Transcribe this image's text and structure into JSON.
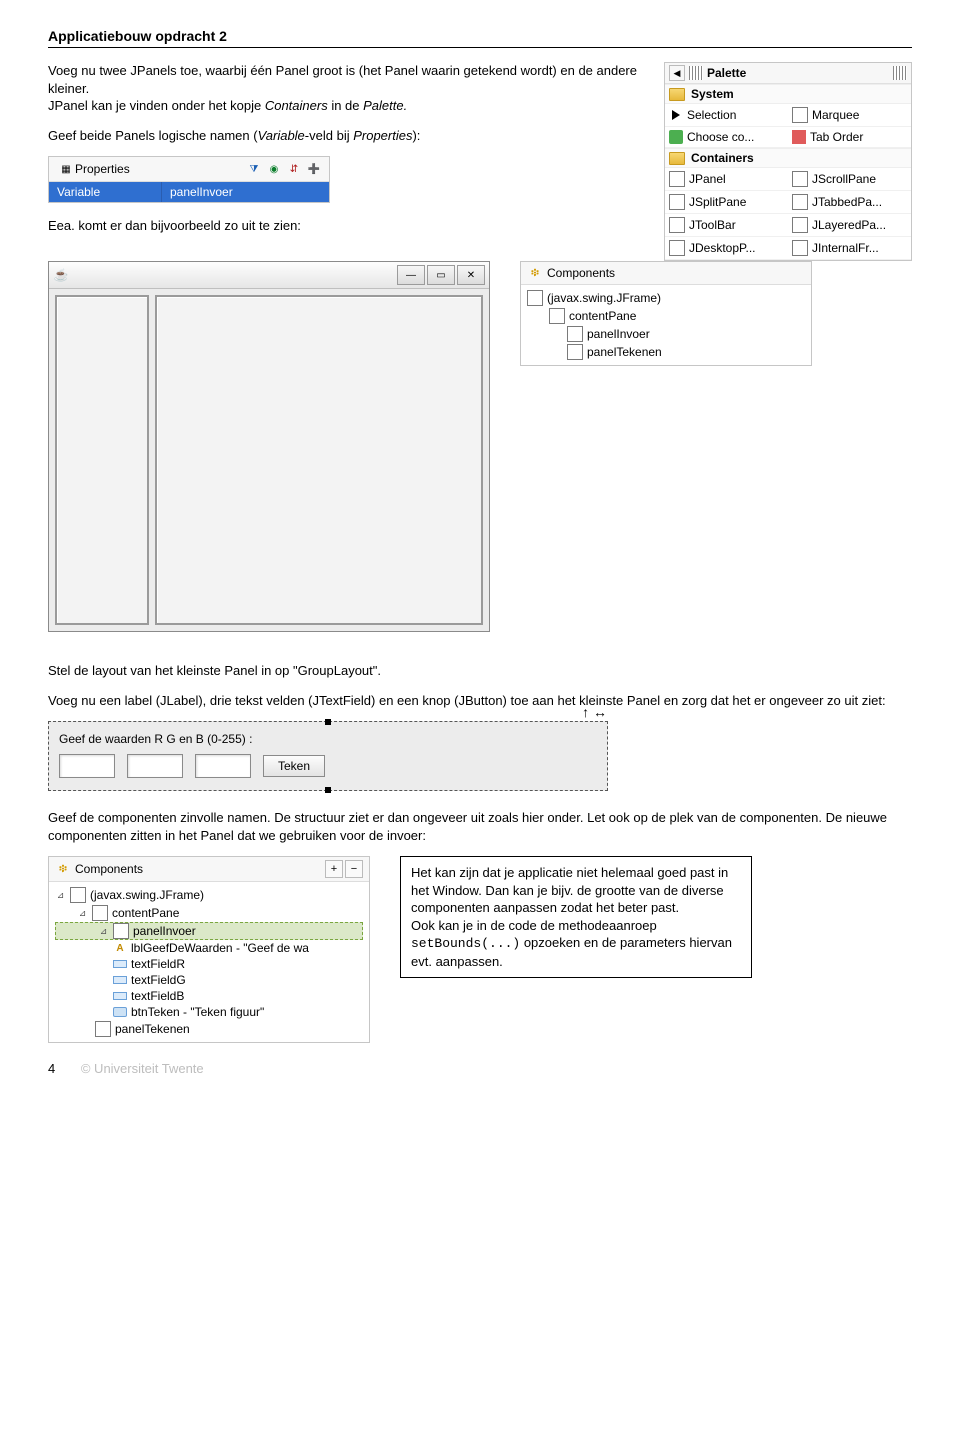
{
  "header": {
    "title": "Applicatiebouw opdracht 2"
  },
  "para1_a": "Voeg nu twee JPanels toe, waarbij één Panel groot is (het Panel waarin getekend wordt) en de andere kleiner.",
  "para1_b_pre": "JPanel kan je vinden onder het kopje ",
  "para1_b_i1": "Containers",
  "para1_b_mid": " in de ",
  "para1_b_i2": "Palette.",
  "para2_pre": "Geef beide Panels logische namen (",
  "para2_i1": "Variable",
  "para2_mid": "-veld bij ",
  "para2_i2": "Properties",
  "para2_post": "):",
  "para3": "Eea. komt er dan bijvoorbeeld zo uit te zien:",
  "para4": "Stel de layout van het kleinste Panel in op \"GroupLayout\".",
  "para5": "Voeg nu een label (JLabel), drie tekst velden (JTextField) en een knop (JButton) toe aan het kleinste Panel en zorg dat het er ongeveer zo uit ziet:",
  "para6": "Geef de componenten zinvolle namen. De structuur ziet er dan ongeveer uit zoals hier onder. Let ook op de plek van de componenten. De nieuwe componenten zitten in het Panel dat we gebruiken voor de invoer:",
  "note_l1": "Het kan zijn dat je applicatie niet helemaal goed past in het Window. Dan kan je bijv. de grootte van de diverse componenten aanpassen zodat het beter past.",
  "note_l2_pre": "Ook kan je in de code de methodeaanroep ",
  "note_code": "setBounds(...)",
  "note_l2_post": " opzoeken en de parameters hiervan evt. aanpassen.",
  "palette": {
    "title": "Palette",
    "folders": {
      "system": "System",
      "containers": "Containers"
    },
    "system_items": [
      "Selection",
      "Marquee",
      "Choose co...",
      "Tab Order"
    ],
    "container_items": [
      "JPanel",
      "JScrollPane",
      "JSplitPane",
      "JTabbedPa...",
      "JToolBar",
      "JLayeredPa...",
      "JDesktopP...",
      "JInternalFr..."
    ]
  },
  "properties": {
    "title": "Properties",
    "key": "Variable",
    "value": "panelInvoer"
  },
  "components1": {
    "title": "Components",
    "root": "(javax.swing.JFrame)",
    "n1": "contentPane",
    "n2": "panelInvoer",
    "n3": "panelTekenen"
  },
  "input_preview": {
    "label": "Geef de waarden R G en B (0-255) :",
    "button": "Teken"
  },
  "components2": {
    "title": "Components",
    "root": "(javax.swing.JFrame)",
    "n1": "contentPane",
    "n2": "panelInvoer",
    "c_label": "lblGeefDeWaarden - \"Geef de wa",
    "c_r": "textFieldR",
    "c_g": "textFieldG",
    "c_b": "textFieldB",
    "c_btn": "btnTeken - \"Teken figuur\"",
    "n3": "panelTekenen"
  },
  "footer": {
    "page": "4",
    "copy": "© Universiteit Twente"
  }
}
